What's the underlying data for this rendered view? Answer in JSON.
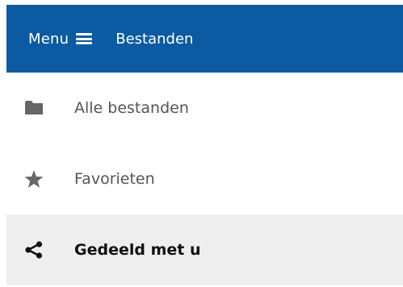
{
  "header": {
    "menu_label": "Menu",
    "app_title": "Bestanden",
    "background_color": "#0b5aa2"
  },
  "menu": {
    "items": [
      {
        "label": "Alle bestanden",
        "icon": "folder-icon",
        "active": false
      },
      {
        "label": "Favorieten",
        "icon": "star-icon",
        "active": false
      },
      {
        "label": "Gedeeld met u",
        "icon": "share-icon",
        "active": true
      }
    ]
  }
}
